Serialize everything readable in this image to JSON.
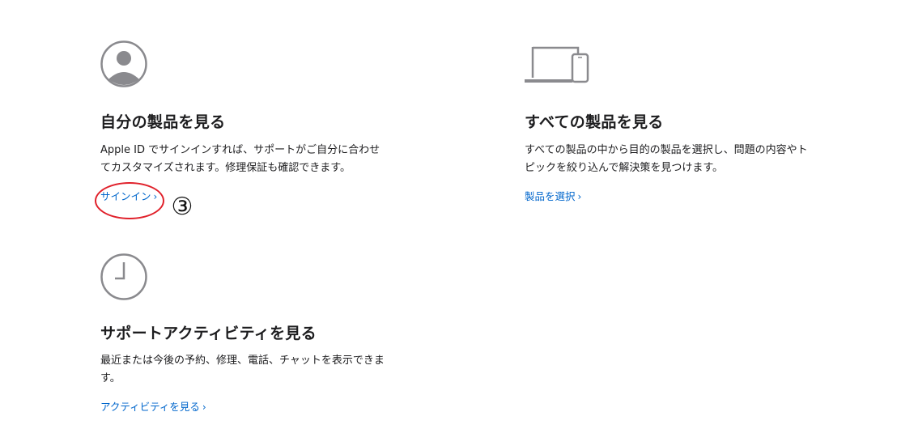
{
  "my_products": {
    "title": "自分の製品を見る",
    "description_line1": "Apple ID でサインインすれば、サポートがご自分に合わせ",
    "description_line2": "てカスタマイズされます。修理保証も確認できます。",
    "link": "サインイン",
    "icon": "person-icon"
  },
  "all_products": {
    "title": "すべての製品を見る",
    "description_line1": "すべての製品の中から目的の製品を選択し、問題の内容やト",
    "description_line2": "ピックを絞り込んで解決策を見つけます。",
    "link": "製品を選択",
    "icon": "laptop-phone-icon"
  },
  "activity": {
    "title": "サポートアクティビティを見る",
    "description_line1": "最近または今後の予約、修理、電話、チャットを表示できま",
    "description_line2": "す。",
    "link": "アクティビティを見る",
    "icon": "clock-icon"
  },
  "annotation": {
    "number": "③",
    "color": "#e0202a"
  },
  "colors": {
    "link": "#0066cc",
    "text": "#1d1d1f",
    "icon": "#8a8a8e"
  }
}
